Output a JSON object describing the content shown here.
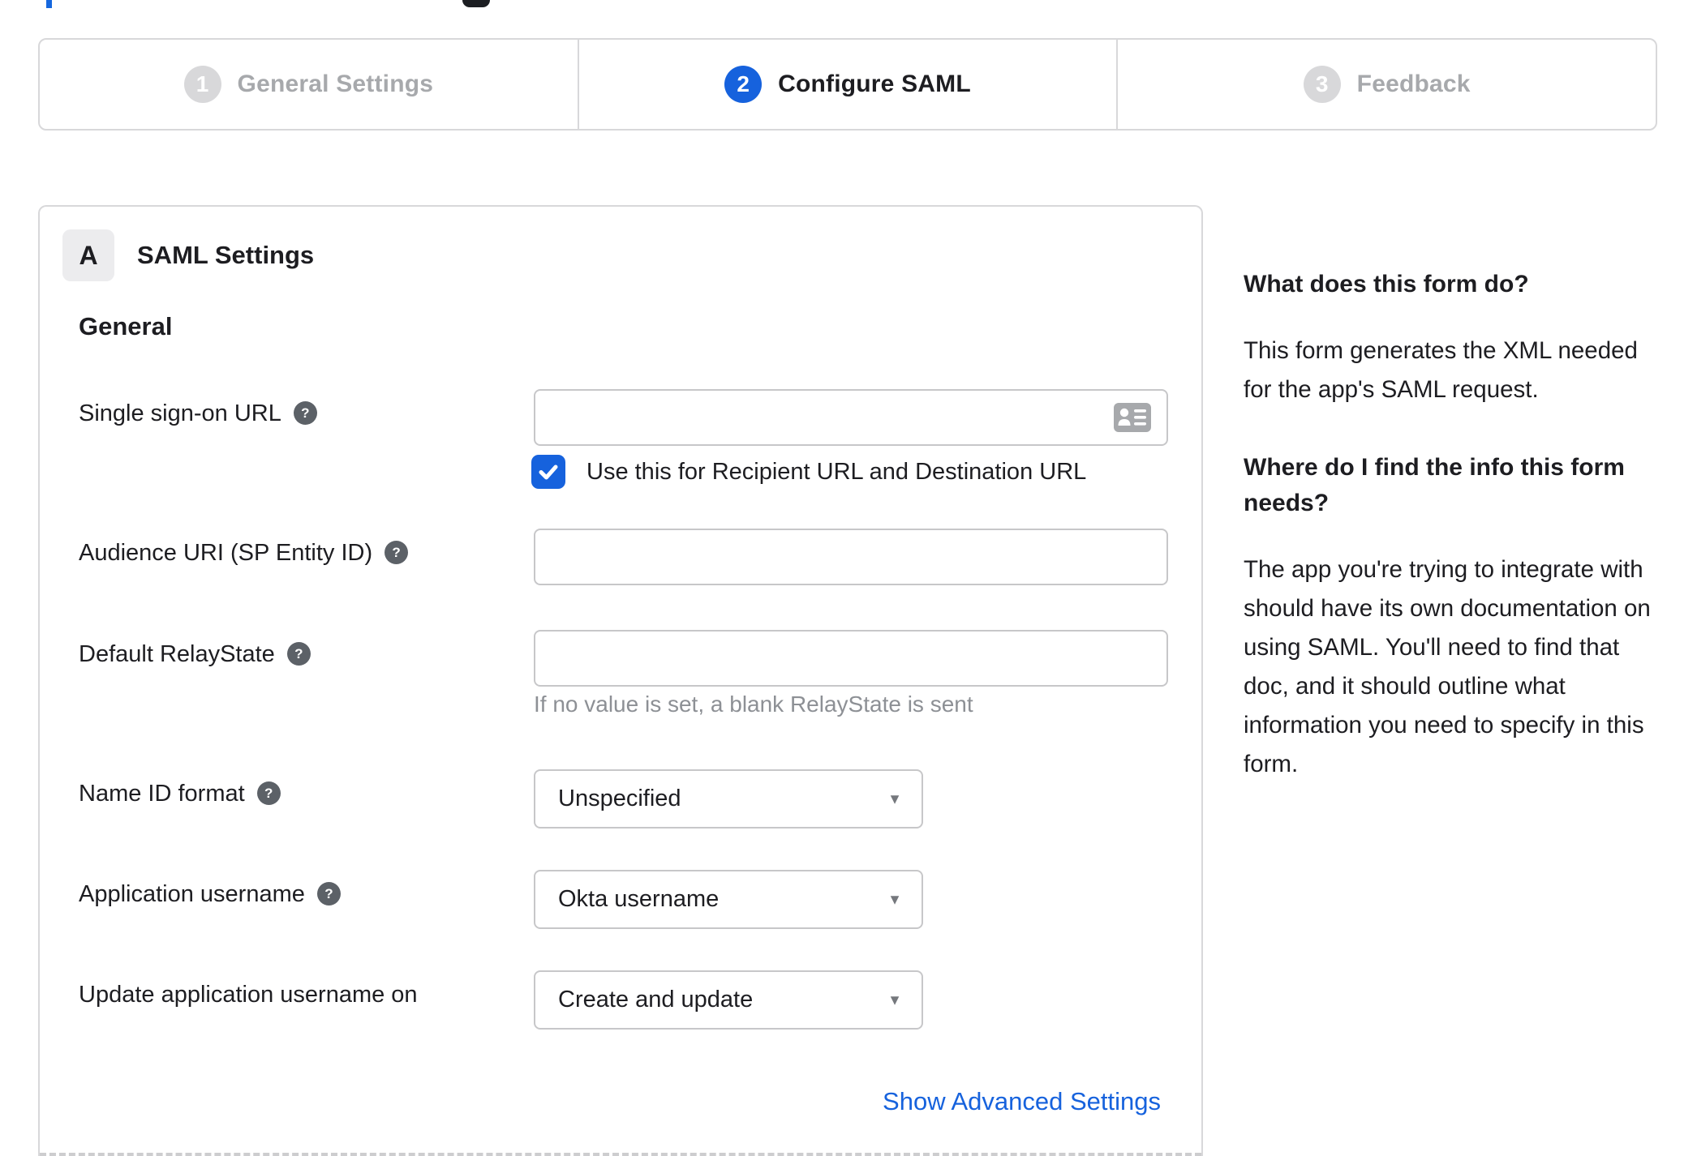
{
  "artifacts": {
    "blue_fragment_color": "#1567de",
    "dark_fragment_color": "#1c1e22"
  },
  "colors": {
    "accent_blue": "#1662dd",
    "inactive_gray": "#a7a9ac",
    "border_gray": "#d8d8da",
    "input_border": "#c7c7c9",
    "text_dark": "#1d1d21",
    "hint_gray": "#8d9095",
    "help_icon_bg": "#5c6167"
  },
  "icons": {
    "help_glyph": "?",
    "caret_glyph": "▼",
    "vcard_icon": "contact-card-icon",
    "check_icon": "checkmark-icon"
  },
  "stepper": {
    "steps": [
      {
        "number": "1",
        "label": "General Settings",
        "state": "inactive"
      },
      {
        "number": "2",
        "label": "Configure SAML",
        "state": "active"
      },
      {
        "number": "3",
        "label": "Feedback",
        "state": "inactive"
      }
    ]
  },
  "panel": {
    "badge": "A",
    "title": "SAML Settings",
    "section_heading": "General",
    "fields": [
      {
        "label": "Single sign-on URL",
        "has_help": true,
        "type": "text",
        "value": ""
      },
      {
        "label": "Audience URI (SP Entity ID)",
        "has_help": true,
        "type": "text",
        "value": ""
      },
      {
        "label": "Default RelayState",
        "has_help": true,
        "type": "text",
        "value": "",
        "hint": "If no value is set, a blank RelayState is sent"
      },
      {
        "label": "Name ID format",
        "has_help": true,
        "type": "select",
        "value": "Unspecified"
      },
      {
        "label": "Application username",
        "has_help": true,
        "type": "select",
        "value": "Okta username"
      },
      {
        "label": "Update application username on",
        "has_help": false,
        "type": "select",
        "value": "Create and update"
      }
    ],
    "checkbox": {
      "label": "Use this for Recipient URL and Destination URL",
      "checked": true
    },
    "advanced_link": "Show Advanced Settings"
  },
  "sidebar": {
    "sections": [
      {
        "heading": "What does this form do?",
        "body": "This form generates the XML needed for the app's SAML request."
      },
      {
        "heading": "Where do I find the info this form needs?",
        "body": "The app you're trying to integrate with should have its own documentation on using SAML. You'll need to find that doc, and it should outline what information you need to specify in this form."
      }
    ]
  }
}
